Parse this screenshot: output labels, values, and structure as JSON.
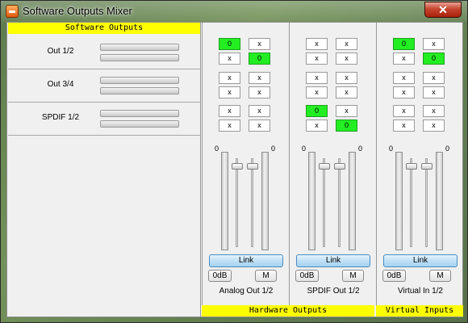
{
  "window": {
    "title": "Software Outputs Mixer",
    "close_label": "✕"
  },
  "software_outputs": {
    "header": "Software Outputs",
    "rows": [
      {
        "label": "Out 1/2"
      },
      {
        "label": "Out 3/4"
      },
      {
        "label": "SPDIF 1/2"
      }
    ]
  },
  "footer": {
    "hardware_outputs": "Hardware Outputs",
    "virtual_inputs": "Virtual Inputs"
  },
  "colors": {
    "panel_header": "#ffff00",
    "routing_active": "#22ee22",
    "link_button": "#bfe0f6"
  },
  "strips": [
    {
      "name": "Analog Out 1/2",
      "routing": [
        [
          {
            "text": "0",
            "active": true
          },
          {
            "text": "x",
            "active": false
          }
        ],
        [
          {
            "text": "x",
            "active": false
          },
          {
            "text": "0",
            "active": true
          }
        ],
        [
          {
            "text": "x",
            "active": false
          },
          {
            "text": "x",
            "active": false
          }
        ],
        [
          {
            "text": "x",
            "active": false
          },
          {
            "text": "x",
            "active": false
          }
        ],
        [
          {
            "text": "x",
            "active": false
          },
          {
            "text": "x",
            "active": false
          }
        ],
        [
          {
            "text": "x",
            "active": false
          },
          {
            "text": "x",
            "active": false
          }
        ]
      ],
      "left_level": "0",
      "right_level": "0",
      "link_label": "Link",
      "zero_db_label": "0dB",
      "mute_label": "M"
    },
    {
      "name": "SPDIF Out 1/2",
      "routing": [
        [
          {
            "text": "x",
            "active": false
          },
          {
            "text": "x",
            "active": false
          }
        ],
        [
          {
            "text": "x",
            "active": false
          },
          {
            "text": "x",
            "active": false
          }
        ],
        [
          {
            "text": "x",
            "active": false
          },
          {
            "text": "x",
            "active": false
          }
        ],
        [
          {
            "text": "x",
            "active": false
          },
          {
            "text": "x",
            "active": false
          }
        ],
        [
          {
            "text": "0",
            "active": true
          },
          {
            "text": "x",
            "active": false
          }
        ],
        [
          {
            "text": "x",
            "active": false
          },
          {
            "text": "0",
            "active": true
          }
        ]
      ],
      "left_level": "0",
      "right_level": "0",
      "link_label": "Link",
      "zero_db_label": "0dB",
      "mute_label": "M"
    },
    {
      "name": "Virtual In 1/2",
      "routing": [
        [
          {
            "text": "0",
            "active": true
          },
          {
            "text": "x",
            "active": false
          }
        ],
        [
          {
            "text": "x",
            "active": false
          },
          {
            "text": "0",
            "active": true
          }
        ],
        [
          {
            "text": "x",
            "active": false
          },
          {
            "text": "x",
            "active": false
          }
        ],
        [
          {
            "text": "x",
            "active": false
          },
          {
            "text": "x",
            "active": false
          }
        ],
        [
          {
            "text": "x",
            "active": false
          },
          {
            "text": "x",
            "active": false
          }
        ],
        [
          {
            "text": "x",
            "active": false
          },
          {
            "text": "x",
            "active": false
          }
        ]
      ],
      "left_level": "0",
      "right_level": "0",
      "link_label": "Link",
      "zero_db_label": "0dB",
      "mute_label": "M"
    }
  ]
}
